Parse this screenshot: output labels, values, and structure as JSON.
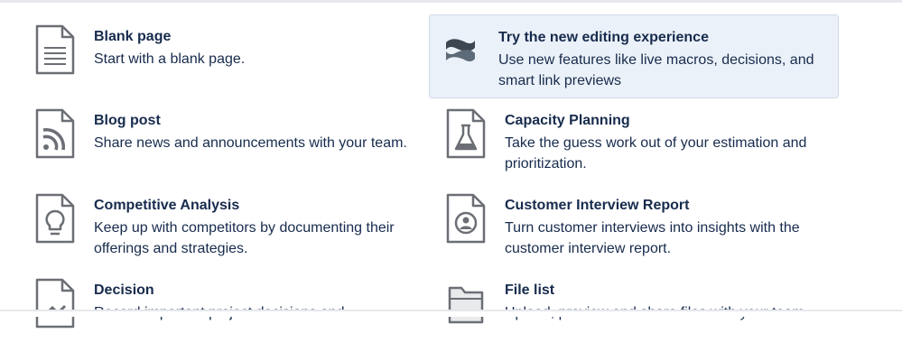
{
  "templates": {
    "blank_page": {
      "title": "Blank page",
      "description": "Start with a blank page.",
      "icon": "blank-page-icon"
    },
    "new_editor": {
      "title": "Try the new editing experience",
      "description": "Use new features like live macros, decisions, and smart link previews",
      "icon": "confluence-logo-icon"
    },
    "blog_post": {
      "title": "Blog post",
      "description": "Share news and announcements with your team.",
      "icon": "rss-icon"
    },
    "capacity_planning": {
      "title": "Capacity Planning",
      "description": "Take the guess work out of your estimation and prioritization.",
      "icon": "flask-icon"
    },
    "competitive_analysis": {
      "title": "Competitive Analysis",
      "description": "Keep up with competitors by documenting their offerings and strategies.",
      "icon": "lightbulb-icon"
    },
    "customer_interview": {
      "title": "Customer Interview Report",
      "description": "Turn customer interviews into insights with the customer interview report.",
      "icon": "user-avatar-icon"
    },
    "decision": {
      "title": "Decision",
      "description": "Record important project decisions and",
      "icon": "decision-icon"
    },
    "file_list": {
      "title": "File list",
      "description": "Upload, preview and share files with your team",
      "icon": "folder-icon"
    }
  },
  "colors": {
    "selected_background": "#ebf1f8",
    "icon_stroke": "#6b6f75",
    "text": "#172b4d"
  }
}
